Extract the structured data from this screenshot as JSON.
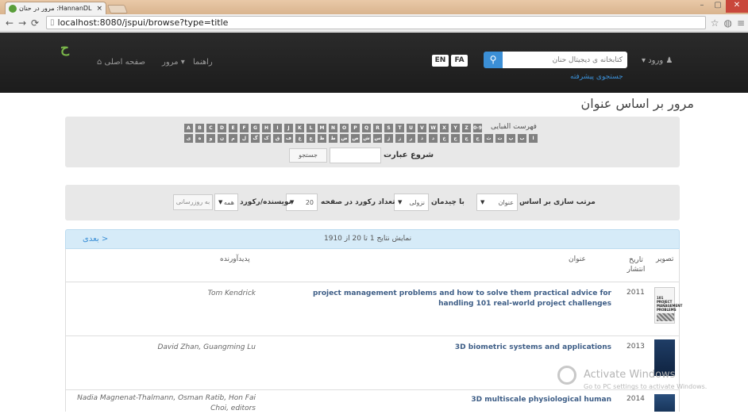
{
  "browser": {
    "tab_title": "HannanDL: مرور در حنان",
    "close_glyph": "×",
    "url_host": "localhost:8080/jspui/browse?type=title",
    "url_rest": ""
  },
  "navbar": {
    "home": "صفحه اصلی",
    "browse": "مرور",
    "help": "راهنما",
    "lang_en": "EN",
    "lang_fa": "FA",
    "search_placeholder": "کتابخانه ی دیجیتال حنان",
    "advanced_search": "جستجوی پیشرفته",
    "login": "ورود"
  },
  "page": {
    "title": "مرور بر اساس عنوان"
  },
  "browse_panel": {
    "alphabet_label": "فهرست الفبایی",
    "latin": [
      "A",
      "B",
      "C",
      "D",
      "E",
      "F",
      "G",
      "H",
      "I",
      "J",
      "K",
      "L",
      "M",
      "N",
      "O",
      "P",
      "Q",
      "R",
      "S",
      "T",
      "U",
      "V",
      "W",
      "X",
      "Y",
      "Z",
      "0-9"
    ],
    "persian": [
      "ی",
      "ه",
      "و",
      "ن",
      "م",
      "ل",
      "گ",
      "ک",
      "ق",
      "ف",
      "غ",
      "ع",
      "ظ",
      "ط",
      "ض",
      "ص",
      "ش",
      "س",
      "ژ",
      "ز",
      "ر",
      "ذ",
      "د",
      "خ",
      "ح",
      "چ",
      "ج",
      "ث",
      "ت",
      "پ",
      "ب",
      "ا"
    ],
    "start_label": "شروع عبارت",
    "go_label": "جستجو"
  },
  "sort_panel": {
    "sort_by_label": "مرتب سازی بر اساس",
    "sort_by_value": "عنوان",
    "order_label": "با چیدمان",
    "order_value": "نزولی",
    "rpp_label": "تعداد رکورد در صفحه",
    "rpp_value": "20",
    "authors_label": "نویسنده/رکورد",
    "authors_value": "همه",
    "update_label": "به روزرسانی"
  },
  "results": {
    "count_text": "نمایش نتایج 1 تا 20 از 1910",
    "next_label": "بعدی >",
    "columns": {
      "image": "تصویر",
      "date": "تاریخ انتشار",
      "title": "عنوان",
      "author": "پدیدآورنده"
    },
    "rows": [
      {
        "date": "2011",
        "title": "project management problems and how to solve them practical advice for handling 101 real-world project challenges",
        "author": "Tom Kendrick",
        "thumb_text": "101 PROJECT MANAGEMENT PROBLEMS"
      },
      {
        "date": "2013",
        "title": "3D biometric systems and applications",
        "author": "David Zhan, Guangming Lu"
      },
      {
        "date": "2014",
        "title": "3D multiscale physiological human",
        "author": "Nadia Magnenat-Thalmann, Osman Ratib, Hon Fai Choi, editors"
      }
    ]
  },
  "watermark": {
    "line1": "Activate Windows",
    "line2": "Go to PC settings to activate Windows."
  }
}
